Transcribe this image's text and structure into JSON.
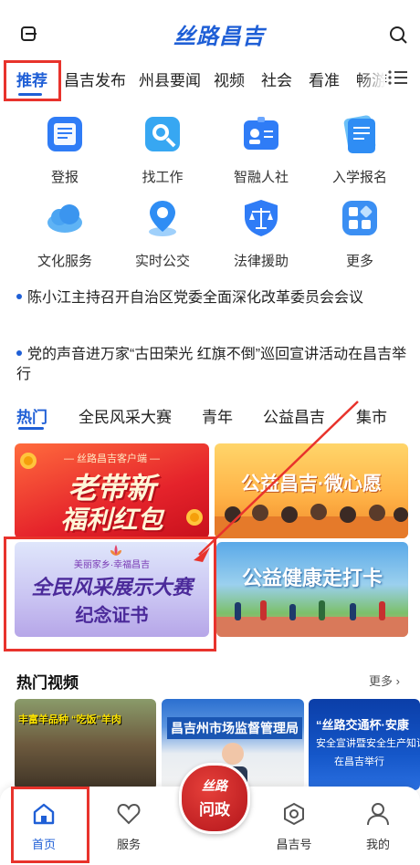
{
  "header": {
    "logo_text": "丝路昌吉"
  },
  "tabs": [
    "推荐",
    "昌吉发布",
    "州县要闻",
    "视频",
    "社会",
    "看准",
    "畅游"
  ],
  "services": [
    {
      "label": "登报",
      "icon": "newspaper-icon"
    },
    {
      "label": "找工作",
      "icon": "job-search-icon"
    },
    {
      "label": "智融人社",
      "icon": "id-card-icon"
    },
    {
      "label": "入学报名",
      "icon": "enrollment-icon"
    },
    {
      "label": "文化服务",
      "icon": "cloud-icon"
    },
    {
      "label": "实时公交",
      "icon": "location-pin-icon"
    },
    {
      "label": "法律援助",
      "icon": "scales-icon"
    },
    {
      "label": "更多",
      "icon": "apps-grid-icon"
    }
  ],
  "news": [
    "陈小江主持召开自治区党委全面深化改革委员会会议",
    "党的声音进万家“古田荣光 红旗不倒”巡回宣讲活动在昌吉举行"
  ],
  "subtabs": [
    "热门",
    "全民风采大赛",
    "青年",
    "公益昌吉",
    "集市"
  ],
  "banners": {
    "b1_top": "— 丝路昌吉客户端 —",
    "b1_line1": "老带新",
    "b1_line2": "福利红包",
    "b2_title": "公益昌吉·微心愿",
    "b3_top": "美丽家乡·幸福昌吉",
    "b3_line1": "全民风采展示大赛",
    "b3_line2": "纪念证书",
    "b4_title": "公益健康走打卡"
  },
  "hot_videos": {
    "title": "热门视频",
    "more": "更多",
    "thumb1_text": "丰富羊品种 “吃饭”羊肉",
    "thumb2_text": "昌吉州市场监督管理局",
    "thumb3_lines": [
      "“丝路交通杯·安康",
      "安全宣讲暨安全生产知识",
      "在昌吉举行"
    ]
  },
  "bottom_nav": {
    "home": "首页",
    "service": "服务",
    "center_top": "丝路",
    "center_bottom": "问政",
    "account": "昌吉号",
    "mine": "我的"
  },
  "colors": {
    "accent": "#1f5fd6",
    "highlight_red": "#e8332c"
  }
}
